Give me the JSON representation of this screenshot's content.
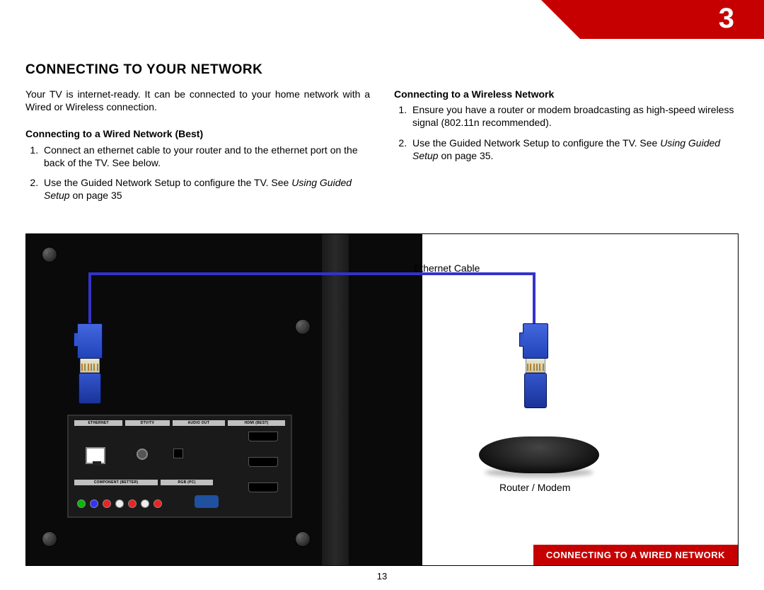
{
  "chapter_number": "3",
  "section_title": "CONNECTING TO YOUR NETWORK",
  "intro_text": "Your TV is internet-ready. It can be connected to your home network with a Wired or Wireless connection.",
  "wired": {
    "heading": "Connecting to a Wired Network (Best)",
    "step1": "Connect an ethernet cable to your router and to the ethernet port on the back of the TV. See below.",
    "step2_a": "Use the Guided Network Setup to configure the TV. See ",
    "step2_ref": "Using Guided Setup",
    "step2_b": " on page 35"
  },
  "wireless": {
    "heading": "Connecting to a Wireless Network",
    "step1": "Ensure you have a router or modem broadcasting as high-speed wireless signal (802.11n recommended).",
    "step2_a": "Use the Guided Network Setup to configure the TV. See ",
    "step2_ref": "Using Guided Setup",
    "step2_b": " on page 35."
  },
  "diagram": {
    "ethernet_cable_label": "Ethernet Cable",
    "router_label": "Router / Modem",
    "caption": "CONNECTING TO A WIRED NETWORK",
    "ports": {
      "ethernet": "ETHERNET",
      "dtv": "DTV/TV",
      "audio_out": "AUDIO OUT",
      "hdmi_best": "HDMI (BEST)",
      "component": "COMPONENT (BETTER)",
      "rgb": "RGB (PC)"
    }
  },
  "page_number": "13"
}
